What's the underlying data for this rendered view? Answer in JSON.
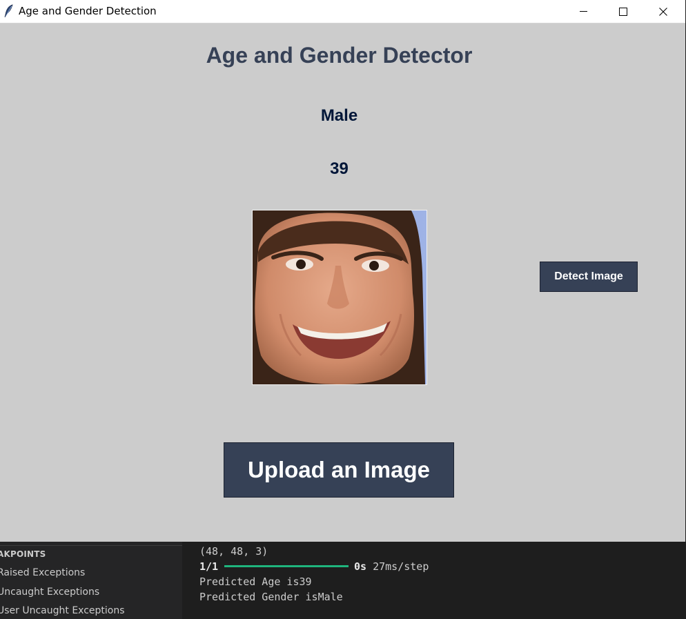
{
  "window": {
    "title": "Age and Gender Detection",
    "icon": "feather-icon",
    "controls": [
      "minimize-icon",
      "maximize-icon",
      "close-icon"
    ]
  },
  "main": {
    "heading": "Age and Gender Detector",
    "gender_result": "Male",
    "age_result": "39",
    "image_description": "face photo",
    "detect_button": "Detect Image",
    "upload_button": "Upload an Image"
  },
  "breakpoints": {
    "header": "AKPOINTS",
    "items": [
      "Raised Exceptions",
      "Uncaught Exceptions",
      "User Uncaught Exceptions"
    ]
  },
  "terminal": {
    "shape_line": "(48, 48, 3)",
    "step": "1/1",
    "progress": 1.0,
    "time": "0s",
    "step_rate": "27ms/step",
    "age_line": "Predicted Age is39",
    "gender_line": "Predicted Gender isMale"
  },
  "colors": {
    "window_bg": "#cccccc",
    "heading": "#364156",
    "result_text": "#011638",
    "button_bg": "#364156",
    "progress": "#1fb57e"
  }
}
